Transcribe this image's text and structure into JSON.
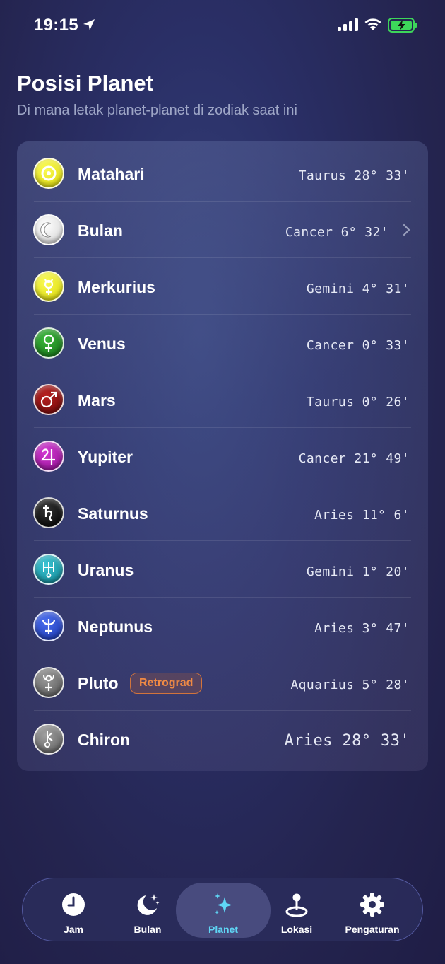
{
  "status_bar": {
    "time": "19:15"
  },
  "header": {
    "title": "Posisi Planet",
    "subtitle": "Di mana letak planet-planet di zodiak saat ini"
  },
  "planets": [
    {
      "name": "Matahari",
      "position": "Taurus 28° 33'",
      "icon": "sun-icon",
      "color": "#e8e500"
    },
    {
      "name": "Bulan",
      "position": "Cancer 6° 32'",
      "icon": "moon-icon",
      "color": "#e8e8e8"
    },
    {
      "name": "Merkurius",
      "position": "Gemini 4° 31'",
      "icon": "mercury-icon",
      "color": "#e5e500"
    },
    {
      "name": "Venus",
      "position": "Cancer 0° 33'",
      "icon": "venus-icon",
      "color": "#1f8a1f"
    },
    {
      "name": "Mars",
      "position": "Taurus 0° 26'",
      "icon": "mars-icon",
      "color": "#8c0f0f"
    },
    {
      "name": "Yupiter",
      "position": "Cancer 21° 49'",
      "icon": "jupiter-icon",
      "color": "#b015b0"
    },
    {
      "name": "Saturnus",
      "position": "Aries 11° 6'",
      "icon": "saturn-icon",
      "color": "#111111"
    },
    {
      "name": "Uranus",
      "position": "Gemini 1° 20'",
      "icon": "uranus-icon",
      "color": "#1aa0b0"
    },
    {
      "name": "Neptunus",
      "position": "Aries 3° 47'",
      "icon": "neptune-icon",
      "color": "#2244cc"
    },
    {
      "name": "Pluto",
      "position": "Aquarius 5° 28'",
      "icon": "pluto-icon",
      "color": "#6f6f6f",
      "badge": "Retrograd"
    },
    {
      "name": "Chiron",
      "position": "Aries 28° 33'",
      "icon": "chiron-icon",
      "color": "#7a7a7a"
    }
  ],
  "tabs": [
    {
      "label": "Jam",
      "icon": "clock-icon"
    },
    {
      "label": "Bulan",
      "icon": "moon-stars-icon"
    },
    {
      "label": "Planet",
      "icon": "sparkles-icon",
      "active": true
    },
    {
      "label": "Lokasi",
      "icon": "location-pin-icon"
    },
    {
      "label": "Pengaturan",
      "icon": "gear-icon"
    }
  ],
  "colors": {
    "accent": "#5fd6f5",
    "badge": "#f08a44"
  }
}
